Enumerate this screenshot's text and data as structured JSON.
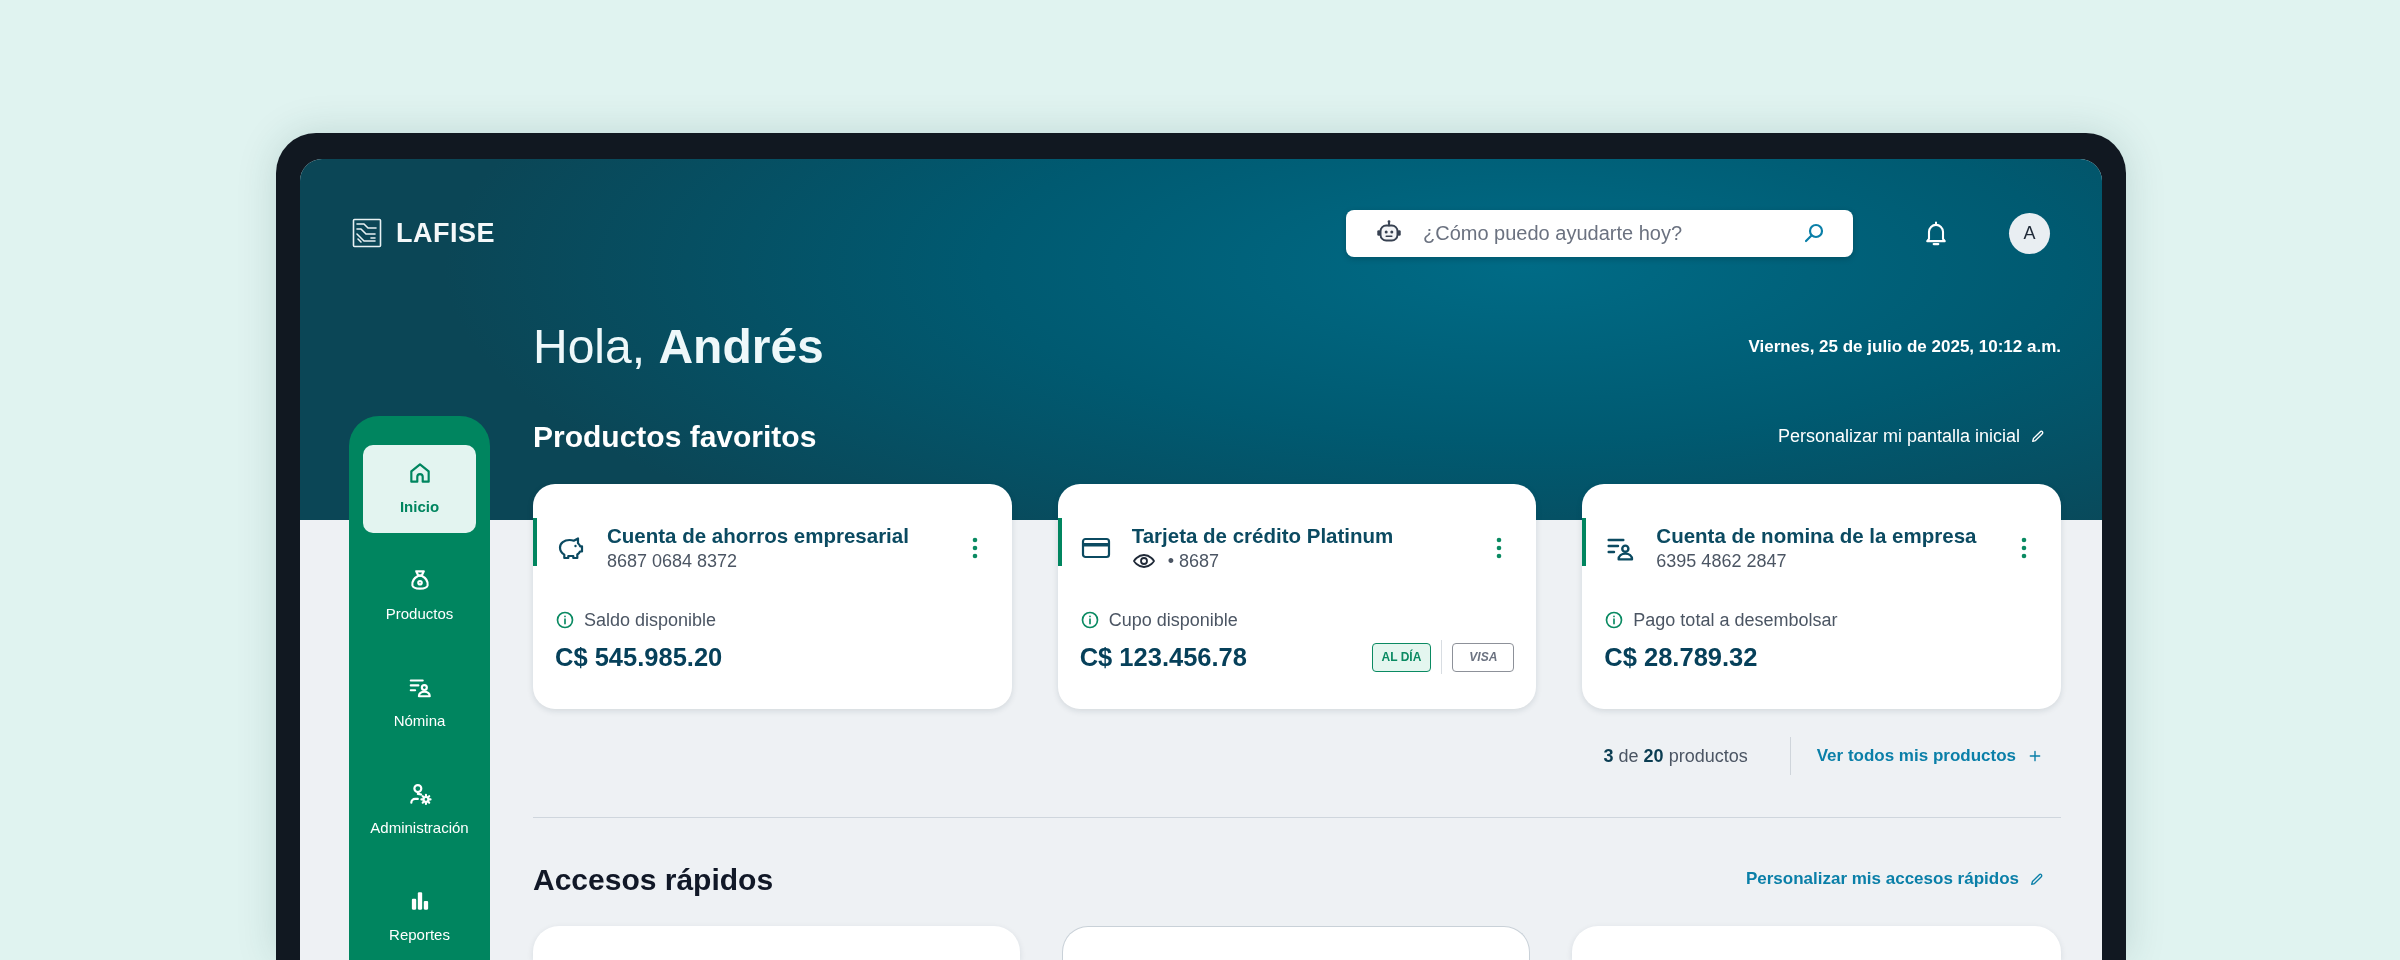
{
  "header": {
    "logo": "LAFISE",
    "search": {
      "placeholder": "¿Cómo puedo ayudarte hoy?"
    },
    "avatar": "A"
  },
  "sidebar": {
    "items": [
      {
        "label": "Inicio",
        "selected": true
      },
      {
        "label": "Productos",
        "selected": false
      },
      {
        "label": "Nómina",
        "selected": false
      },
      {
        "label": "Administración",
        "selected": false
      },
      {
        "label": "Reportes",
        "selected": false
      }
    ]
  },
  "greeting": "Hola, **Andrés**",
  "date": "Viernes, 25 de julio de 2025, 10:12 a.m.",
  "favorites": {
    "title": "Productos favoritos",
    "customize_link": "Personalizar mi pantalla inicial",
    "products": [
      {
        "kind": "account",
        "name": "Cuenta de ahorros empresarial",
        "number": "8687 0684 8372",
        "balance_label": "Saldo disponible",
        "balance": "C$ 545.985.20"
      },
      {
        "kind": "card",
        "name": "Tarjeta de crédito Platinum",
        "number": "• 8687",
        "balance_label": "Cupo disponible",
        "balance": "C$ 123.456.78",
        "badges": [
          {
            "kind": "status",
            "label": "AL DÍA"
          },
          {
            "kind": "brand",
            "label": "VISA"
          }
        ]
      },
      {
        "kind": "account",
        "name": "Cuenta de nomina de la empresa",
        "number": "6395 4862 2847",
        "balance_label": "Pago total a desembolsar",
        "balance": "C$ 28.789.32"
      }
    ],
    "count": "**3** de **20** productos",
    "view_all_link": "Ver todos mis productos"
  },
  "quick_access": {
    "title": "Accesos rápidos",
    "customize_link": "Personalizar mis accesos rápidos"
  }
}
